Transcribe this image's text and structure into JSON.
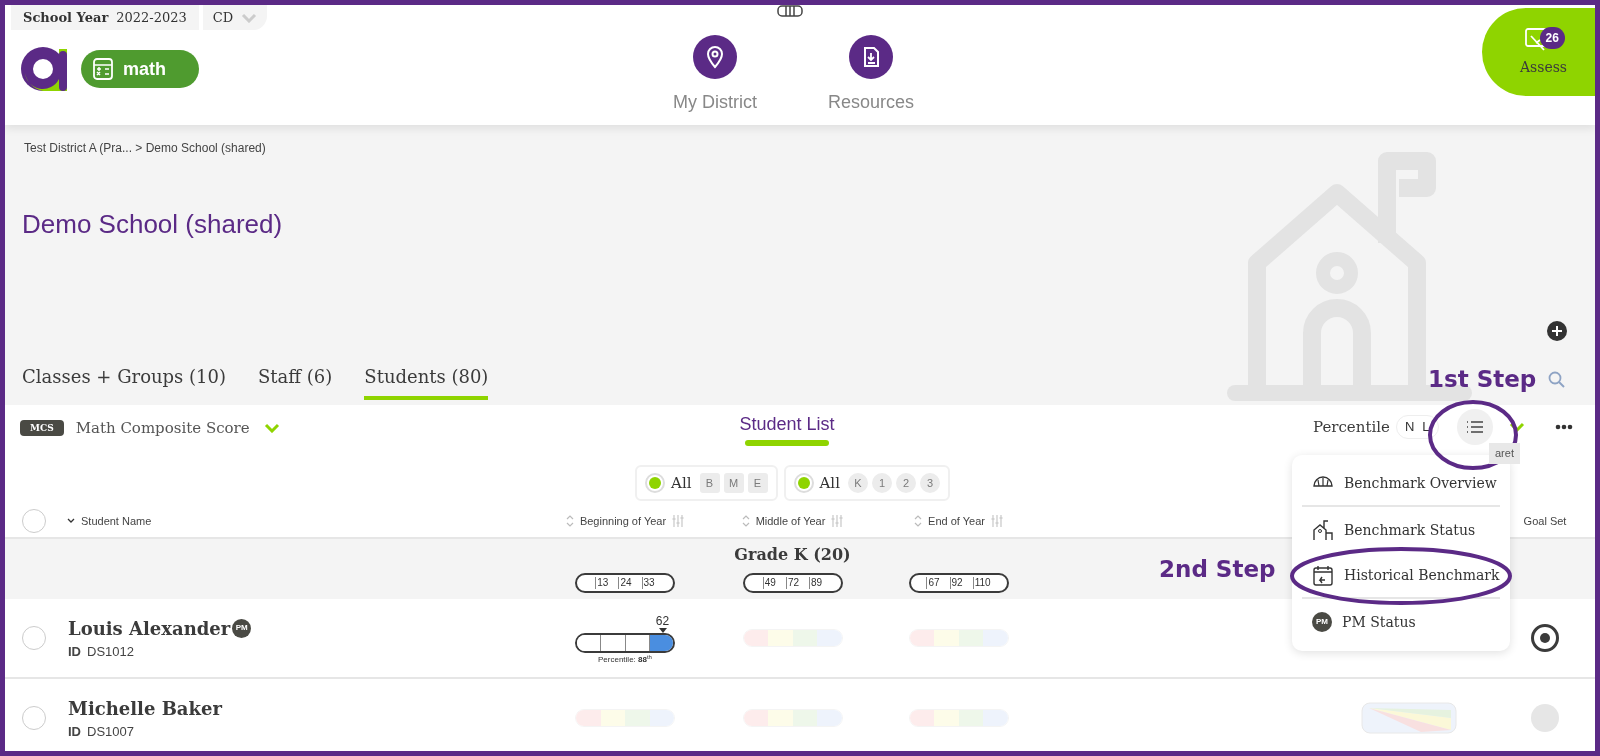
{
  "top_bar": {
    "school_year_label": "School Year",
    "school_year": "2022-2023",
    "dropdown": "CD"
  },
  "subject": {
    "label": "math"
  },
  "nav": [
    {
      "label": "My District"
    },
    {
      "label": "Resources"
    }
  ],
  "assess": {
    "label": "Assess",
    "badge": "26"
  },
  "breadcrumb": "Test District A (Pra... > Demo School (shared)",
  "title": "Demo School (shared)",
  "tabs": [
    {
      "label": "Classes + Groups (10)",
      "selected": false
    },
    {
      "label": "Staff (6)",
      "selected": false
    },
    {
      "label": "Students (80)",
      "selected": true
    }
  ],
  "annotations": [
    {
      "text": "1st Step"
    },
    {
      "text": "2nd Step"
    }
  ],
  "toolbar": {
    "measure_badge": "MCS",
    "measure": "Math Composite Score",
    "view_title": "Student List",
    "score_label": "Percentile",
    "score_options": [
      {
        "label": "N",
        "selected": false
      },
      {
        "label": "L",
        "selected": false
      }
    ],
    "list_button_highlighted": true,
    "tooltip": "aret"
  },
  "filters": [
    {
      "label": "All",
      "selected": true,
      "options": [
        {
          "label": "B",
          "kind": "period"
        },
        {
          "label": "M",
          "kind": "period"
        },
        {
          "label": "E",
          "kind": "period"
        }
      ]
    },
    {
      "label": "All",
      "selected": true,
      "options": [
        {
          "label": "K",
          "kind": "grade"
        },
        {
          "label": "1",
          "kind": "grade"
        },
        {
          "label": "2",
          "kind": "grade"
        },
        {
          "label": "3",
          "kind": "grade"
        }
      ]
    }
  ],
  "select_all": {
    "selected": false
  },
  "columns": [
    {
      "label": "Student Name",
      "kind": "name",
      "sorted": true
    },
    {
      "label": "Beginning of Year",
      "kind": "period",
      "sorted": false
    },
    {
      "label": "Middle of Year",
      "kind": "period",
      "sorted": false
    },
    {
      "label": "End of Year",
      "kind": "period",
      "sorted": false
    },
    {
      "label": "Goal Set",
      "kind": "goal"
    }
  ],
  "group": {
    "label": "Grade K (20)",
    "cutpoints": [
      [
        "13",
        "24",
        "33"
      ],
      [
        "49",
        "72",
        "89"
      ],
      [
        "67",
        "92",
        "110"
      ]
    ]
  },
  "students": [
    {
      "name": "Louis Alexander",
      "pm_badge": "PM",
      "id_label": "ID",
      "id": "DS1012",
      "selected": false,
      "scores": [
        {
          "kind": "score",
          "score": "62",
          "filled_segments": [
            false,
            false,
            false,
            true
          ],
          "percentile": "Percentile: **88**$^{th}$"
        },
        {
          "kind": "empty"
        },
        {
          "kind": "empty"
        }
      ],
      "history_chart": false,
      "goal_set": {
        "checked": true,
        "disabled": false
      }
    },
    {
      "name": "Michelle Baker",
      "id_label": "ID",
      "id": "DS1007",
      "selected": false,
      "scores": [
        {
          "kind": "empty"
        },
        {
          "kind": "empty"
        },
        {
          "kind": "empty"
        }
      ],
      "history_chart": true,
      "goal_set": {
        "checked": false,
        "disabled": true
      }
    }
  ],
  "menu": [
    {
      "label": "Benchmark Overview",
      "highlighted": false,
      "divider_after": true
    },
    {
      "label": "Benchmark Status",
      "highlighted": false,
      "divider_after": false
    },
    {
      "label": "Historical Benchmark",
      "highlighted": true,
      "divider_after": true
    },
    {
      "label": "PM Status",
      "badge": "PM",
      "highlighted": false,
      "divider_after": false
    }
  ]
}
